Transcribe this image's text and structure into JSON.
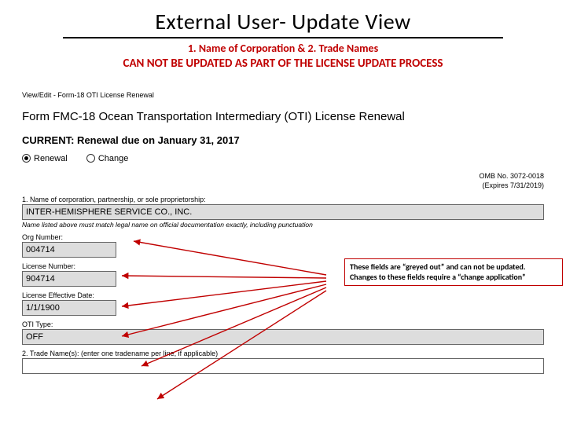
{
  "title": "External User- Update View",
  "subtitle1": "1. Name of Corporation & 2. Trade Names",
  "subtitle2": "CAN NOT BE UPDATED AS PART OF THE LICENSE UPDATE PROCESS",
  "breadcrumb": "View/Edit - Form-18 OTI License Renewal",
  "form_header": "Form FMC-18  Ocean Transportation Intermediary (OTI) License Renewal",
  "current_line": "CURRENT: Renewal due on January 31, 2017",
  "radios": {
    "renewal": "Renewal",
    "change": "Change"
  },
  "omb": {
    "line1": "OMB No. 3072-0018",
    "line2": "(Expires 7/31/2019)"
  },
  "fields": {
    "name_label": "1. Name of corporation, partnership, or sole proprietorship:",
    "name_value": "INTER-HEMISPHERE SERVICE CO., INC.",
    "name_helper": "Name listed above must match legal name on official documentation exactly, including punctuation",
    "org_label": "Org Number:",
    "org_value": "004714",
    "license_label": "License Number:",
    "license_value": "904714",
    "eff_label": "License Effective Date:",
    "eff_value": "1/1/1900",
    "oti_label": "OTI Type:",
    "oti_value": "OFF",
    "trade_label": "2. Trade Name(s): (enter one tradename per line, if applicable)",
    "trade_value": ""
  },
  "callout": {
    "line1": "These fields are “greyed out” and can not be updated.",
    "line2": "Changes to these fields require a “change application”"
  }
}
